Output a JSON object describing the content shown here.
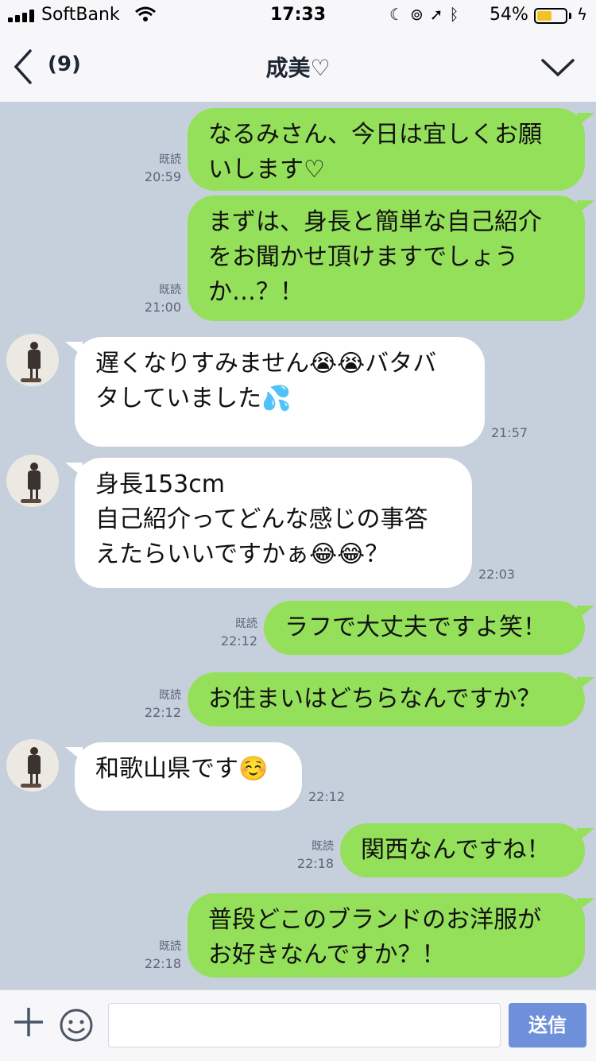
{
  "status_bar": {
    "carrier": "SoftBank",
    "time": "17:33",
    "battery_percent": "54%",
    "battery_level": 0.54,
    "icons": [
      "signal-icon",
      "wifi-icon",
      "moon-icon",
      "rotation-lock-icon",
      "location-icon",
      "bluetooth-icon",
      "battery-icon",
      "charging-icon"
    ]
  },
  "header": {
    "back_icon": "chevron-left-icon",
    "unread_count": "(9)",
    "title": "成美♡",
    "menu_icon": "chevron-down-icon"
  },
  "messages": [
    {
      "side": "sent",
      "text": "なるみさん、今日は宜しくお願\nいします♡",
      "read": "既読",
      "time": "20:59"
    },
    {
      "side": "sent",
      "text": "まずは、身長と簡単な自己紹介\nをお聞かせ頂けますでしょう\nか…？！",
      "read": "既読",
      "time": "21:00"
    },
    {
      "side": "recv",
      "text": "遅くなりすみません😭😭バタバ\nタしていました💦",
      "time": "21:57"
    },
    {
      "side": "recv",
      "text": "身長153cm\n自己紹介ってどんな感じの事答\nえたらいいですかぁ😂😂？",
      "time": "22:03"
    },
    {
      "side": "sent",
      "text": "ラフで大丈夫ですよ笑！",
      "read": "既読",
      "time": "22:12"
    },
    {
      "side": "sent",
      "text": "お住まいはどちらなんですか？",
      "read": "既読",
      "time": "22:12"
    },
    {
      "side": "recv",
      "text": "和歌山県です☺️",
      "time": "22:12"
    },
    {
      "side": "sent",
      "text": "関西なんですね！",
      "read": "既読",
      "time": "22:18"
    },
    {
      "side": "sent",
      "text": "普段どこのブランドのお洋服が\nお好きなんですか？！",
      "read": "既読",
      "time": "22:18"
    }
  ],
  "input_bar": {
    "plus_icon": "plus-icon",
    "emoji_icon": "smiley-icon",
    "message_value": "",
    "send_label": "送信"
  },
  "colors": {
    "chat_background": "#c6cfdc",
    "sent_bubble": "#95e05a",
    "received_bubble": "#ffffff",
    "send_button": "#6e8fd9"
  }
}
